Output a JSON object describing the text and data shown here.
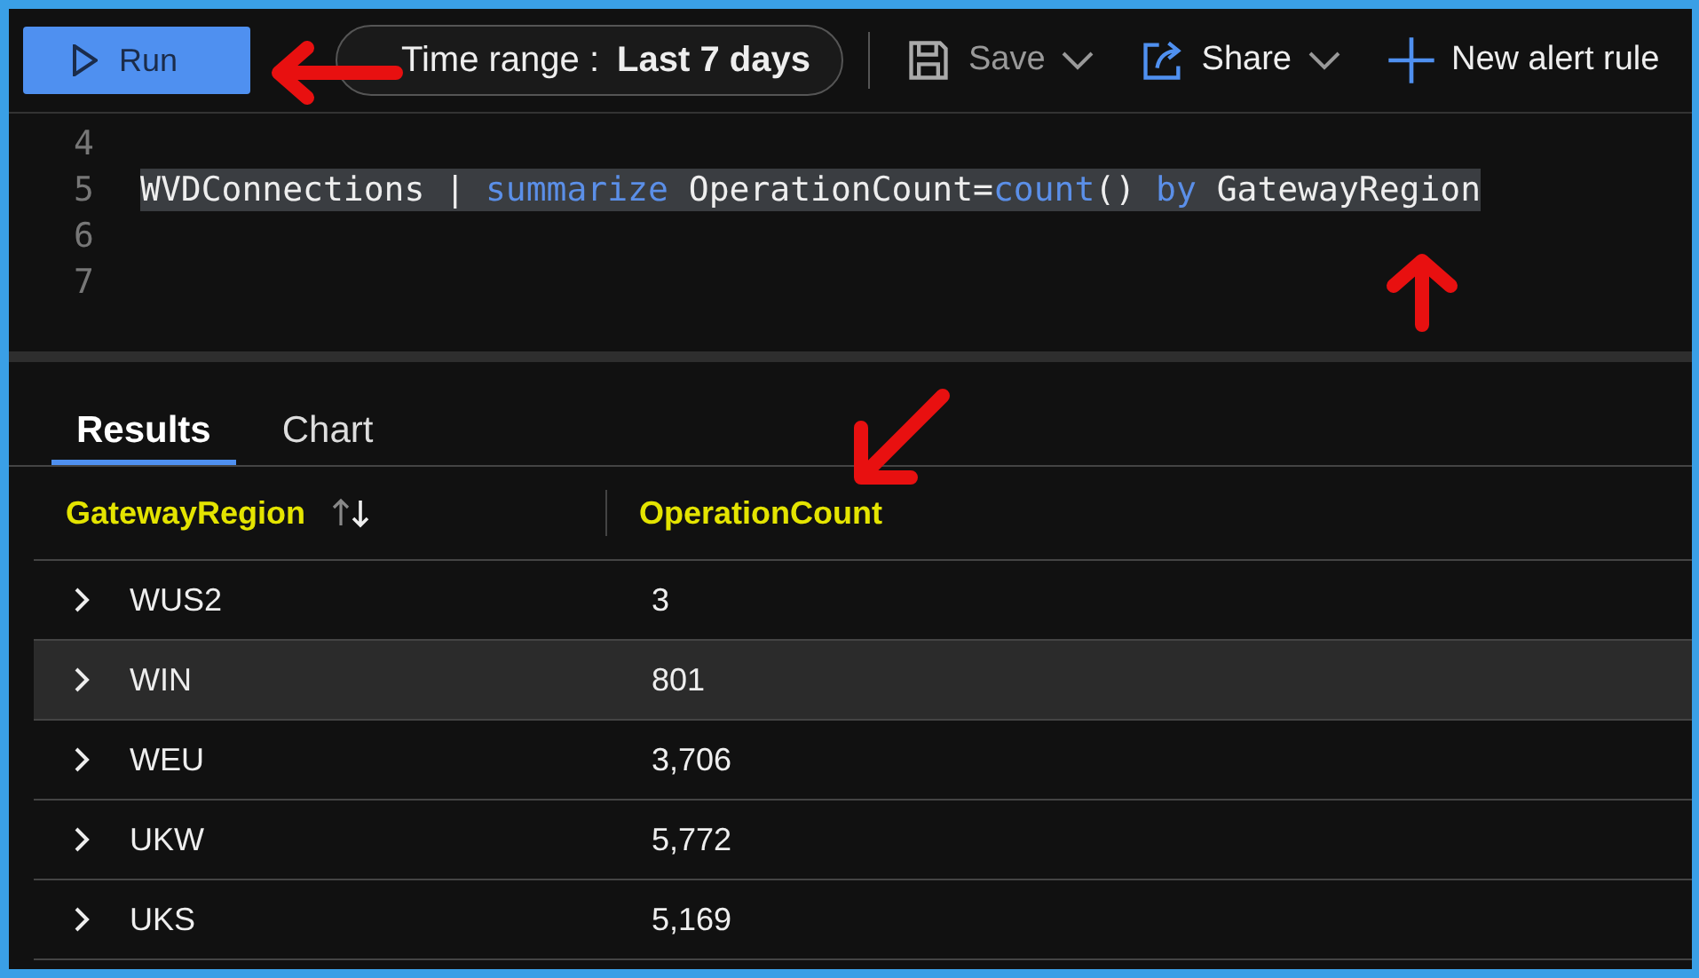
{
  "toolbar": {
    "run_button": "Run",
    "time_range": {
      "label": "Time range :",
      "value": "Last 7 days"
    },
    "actions": [
      {
        "kind": "save",
        "label": "Save",
        "disabled": true
      },
      {
        "kind": "share",
        "label": "Share",
        "disabled": false
      },
      {
        "kind": "alert",
        "label": "New alert rule",
        "disabled": false
      }
    ]
  },
  "editor": {
    "lines": [
      {
        "number": "4",
        "selected": false
      },
      {
        "number": "5",
        "selected": true,
        "tokens": [
          {
            "kind": "plain",
            "text": "WVDConnections "
          },
          {
            "kind": "plain",
            "text": "| "
          },
          {
            "kind": "keyword",
            "text": "summarize "
          },
          {
            "kind": "plain",
            "text": "OperationCount="
          },
          {
            "kind": "keyword",
            "text": "count"
          },
          {
            "kind": "plain",
            "text": "() "
          },
          {
            "kind": "keyword",
            "text": "by "
          },
          {
            "kind": "plain",
            "text": "GatewayRegion"
          }
        ]
      },
      {
        "number": "6",
        "selected": false
      },
      {
        "number": "7",
        "selected": false
      }
    ]
  },
  "result_tabs": [
    {
      "label": "Results",
      "selected": true
    },
    {
      "label": "Chart",
      "selected": false
    }
  ],
  "table": {
    "columns": [
      {
        "label": "GatewayRegion",
        "sortable": true
      },
      {
        "label": "OperationCount",
        "sortable": false
      }
    ],
    "rows": [
      {
        "cells": [
          "WUS2",
          "3"
        ],
        "selected": false
      },
      {
        "cells": [
          "WIN",
          "801"
        ],
        "selected": true
      },
      {
        "cells": [
          "WEU",
          "3,706"
        ],
        "selected": false
      },
      {
        "cells": [
          "UKW",
          "5,772"
        ],
        "selected": false
      },
      {
        "cells": [
          "UKS",
          "5,169"
        ],
        "selected": false
      }
    ]
  }
}
